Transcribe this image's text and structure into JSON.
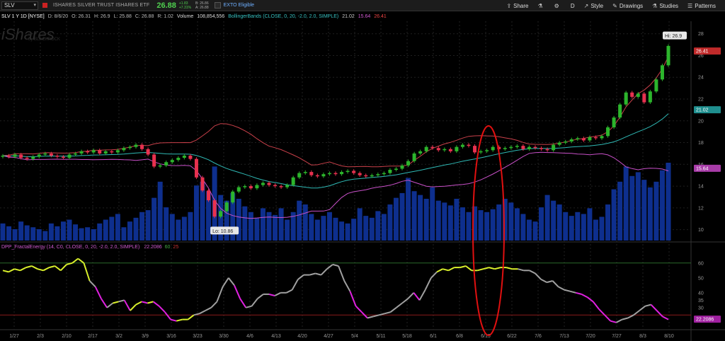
{
  "header": {
    "symbol": "SLV",
    "etf_name": "ISHARES SILVER TRUST ISHARES ETF",
    "last": "26.88",
    "change": "+1.83",
    "change_pct": "+7.31%",
    "bid": "B: 26.86",
    "ask": "A: 26.88",
    "etb": "EXTO Eligible"
  },
  "toolbar": {
    "share": "Share",
    "period": "D",
    "style": "Style",
    "drawings": "Drawings",
    "studies": "Studies",
    "patterns": "Patterns"
  },
  "infobar": {
    "symbol_period": "SLV 1 Y 1D [NYSE]",
    "date": "D: 8/6/20",
    "open": "O: 26.31",
    "high": "H: 26.9",
    "low": "L: 25.88",
    "close": "C: 26.88",
    "range": "R: 1.02",
    "volume_label": "Volume",
    "volume_value": "108,854,556",
    "bb_label": "BollingerBands (CLOSE, 0, 20, -2.0, 2.0, SIMPLE)",
    "bb_upper": "21.02",
    "bb_mid": "15.64",
    "bb_lower": "26.41"
  },
  "indicator": {
    "label": "DPP_FractalEnergy (14, C0, CLOSE, 0, 20, -2.0, 2.0, SIMPLE)",
    "value": "22.2086",
    "band1": "60",
    "band2": "25"
  },
  "watermark": {
    "brand": "iShares",
    "sub": "by BLACKROCK"
  },
  "colors": {
    "bull": "#2cb52c",
    "bear": "#e8314f",
    "volume": "#0e2f8e",
    "bb_upper": "#c9404a",
    "bb_mid": "#2fb9b5",
    "bb_lower": "#c850c8",
    "fe_yellow": "#d9f02b",
    "fe_gray": "#a0a0a0",
    "fe_magenta": "#e020e0",
    "annotation": "#e01010"
  },
  "chart_data": {
    "type": "candlestick",
    "price_axis": {
      "ticks": [
        10,
        12,
        14,
        16,
        18,
        20,
        22,
        24,
        26,
        28
      ],
      "range": [
        9,
        28.5
      ]
    },
    "indicator_axis": {
      "ticks": [
        30,
        40,
        50,
        60
      ],
      "range": [
        18,
        68
      ],
      "levels": [
        60,
        25
      ],
      "extra_label": "35"
    },
    "date_labels": [
      "1/27",
      "2/3",
      "2/10",
      "2/17",
      "3/2",
      "3/9",
      "3/16",
      "3/23",
      "3/30",
      "4/6",
      "4/13",
      "4/20",
      "4/27",
      "5/4",
      "5/11",
      "5/18",
      "6/1",
      "6/8",
      "6/15",
      "6/22",
      "7/6",
      "7/13",
      "7/20",
      "7/27",
      "8/3",
      "8/10"
    ],
    "hi_label": "Hi: 26.9",
    "lo_label": "Lo: 10.86",
    "last_tags": {
      "price": "26.41",
      "bb_mid": "21.02",
      "bb_lower": "15.64",
      "fe": "22.2086"
    },
    "closes": [
      16.8,
      16.7,
      16.9,
      16.6,
      16.5,
      16.7,
      16.9,
      17.0,
      16.8,
      16.7,
      16.6,
      16.9,
      17.0,
      17.2,
      17.1,
      17.3,
      17.0,
      17.2,
      17.1,
      17.3,
      17.5,
      17.6,
      17.8,
      17.4,
      16.9,
      15.8,
      15.9,
      16.2,
      16.4,
      16.6,
      16.8,
      16.5,
      14.8,
      13.6,
      12.7,
      11.2,
      11.7,
      12.5,
      13.5,
      13.9,
      14.0,
      13.8,
      14.1,
      14.3,
      14.1,
      14.0,
      13.9,
      14.1,
      14.8,
      15.2,
      15.3,
      15.0,
      14.9,
      15.1,
      15.2,
      15.1,
      15.3,
      15.4,
      15.2,
      15.0,
      14.9,
      15.0,
      15.1,
      15.2,
      15.5,
      15.6,
      15.9,
      16.3,
      17.0,
      17.2,
      17.6,
      17.5,
      17.3,
      17.4,
      17.2,
      17.6,
      17.8,
      17.7,
      17.1,
      17.2,
      17.3,
      17.6,
      17.4,
      17.5,
      17.6,
      17.7,
      17.4,
      17.6,
      17.5,
      17.4,
      17.3,
      17.8,
      18.0,
      18.1,
      18.3,
      18.4,
      18.2,
      18.5,
      18.4,
      18.6,
      19.4,
      20.3,
      21.5,
      22.6,
      22.2,
      22.5,
      21.7,
      22.7,
      23.8,
      25.1,
      26.88
    ],
    "volumes": [
      0.18,
      0.15,
      0.12,
      0.2,
      0.16,
      0.14,
      0.12,
      0.1,
      0.18,
      0.15,
      0.2,
      0.22,
      0.17,
      0.13,
      0.14,
      0.12,
      0.18,
      0.22,
      0.25,
      0.28,
      0.14,
      0.2,
      0.24,
      0.3,
      0.32,
      0.45,
      0.62,
      0.35,
      0.28,
      0.22,
      0.25,
      0.3,
      0.58,
      0.62,
      0.52,
      0.78,
      0.48,
      0.42,
      0.5,
      0.44,
      0.36,
      0.3,
      0.24,
      0.34,
      0.3,
      0.27,
      0.34,
      0.22,
      0.3,
      0.42,
      0.38,
      0.28,
      0.22,
      0.26,
      0.3,
      0.24,
      0.2,
      0.18,
      0.23,
      0.34,
      0.26,
      0.24,
      0.31,
      0.28,
      0.38,
      0.45,
      0.5,
      0.66,
      0.52,
      0.48,
      0.44,
      0.56,
      0.42,
      0.4,
      0.37,
      0.44,
      0.35,
      0.3,
      0.36,
      0.32,
      0.3,
      0.33,
      0.38,
      0.44,
      0.4,
      0.34,
      0.28,
      0.22,
      0.2,
      0.35,
      0.48,
      0.42,
      0.38,
      0.3,
      0.26,
      0.3,
      0.28,
      0.34,
      0.22,
      0.25,
      0.38,
      0.54,
      0.62,
      0.78,
      0.68,
      0.72,
      0.64,
      0.56,
      0.62,
      0.74,
      0.82
    ],
    "fractal_energy": [
      55,
      54,
      56,
      55,
      57,
      58,
      56,
      55,
      57,
      58,
      55,
      59,
      60,
      63,
      60,
      48,
      44,
      36,
      30,
      33,
      34,
      35,
      28,
      32,
      34,
      33,
      34,
      31,
      27,
      22,
      21,
      22,
      22,
      25,
      26,
      28,
      30,
      34,
      44,
      50,
      45,
      36,
      30,
      31,
      36,
      39,
      39,
      38,
      40,
      40,
      42,
      49,
      52,
      52,
      53,
      52,
      56,
      59,
      58,
      48,
      41,
      31,
      27,
      23,
      24,
      25,
      26,
      27,
      30,
      33,
      36,
      40,
      35,
      42,
      50,
      54,
      56,
      55,
      57,
      57,
      58,
      55,
      55,
      56,
      57,
      56,
      57,
      57,
      56,
      56,
      55,
      55,
      53,
      49,
      47,
      48,
      44,
      42,
      41,
      40,
      39,
      37,
      34,
      29,
      25,
      21,
      20,
      22,
      23,
      25,
      28,
      31,
      32,
      28,
      24,
      22
    ]
  }
}
